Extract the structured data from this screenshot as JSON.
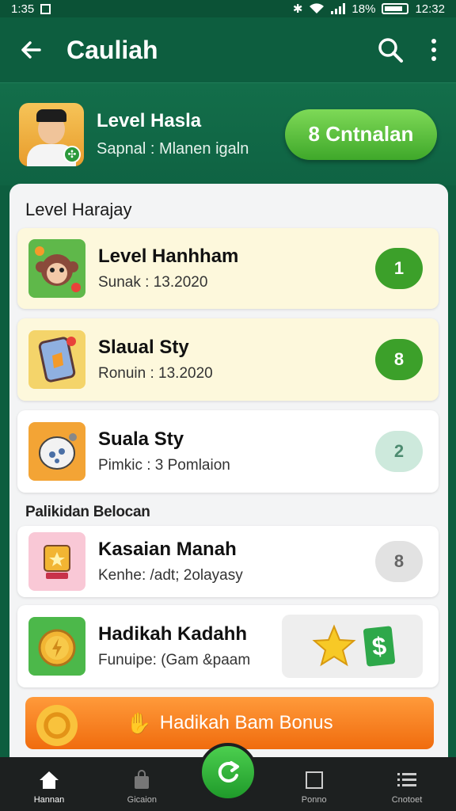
{
  "status_bar": {
    "left_text": "1:35",
    "battery_text": "18%",
    "time": "12:32"
  },
  "app_bar": {
    "title": "Cauliah",
    "back_icon": "arrow-left-icon",
    "search_icon": "search-icon",
    "menu_icon": "more-vertical-icon"
  },
  "profile": {
    "name": "Level Hasla",
    "subtitle": "Sapnal : Mlanen igaln",
    "claim_label": "8 Cntnalan"
  },
  "section1": {
    "title": "Level Harajay",
    "items": [
      {
        "title": "Level Hanhham",
        "subtitle": "Sunak : 13.2020",
        "badge": "1"
      },
      {
        "title": "Slaual Sty",
        "subtitle": "Ronuin : 13.2020",
        "badge": "8"
      },
      {
        "title": "Suala Sty",
        "subtitle": "Pimkic : 3 Pomlaion",
        "badge": "2"
      }
    ]
  },
  "section2": {
    "title": "Palikidan Belocan",
    "items": [
      {
        "title": "Kasaian Manah",
        "subtitle": "Kenhe: /adt; 2olayasy",
        "badge": "8"
      },
      {
        "title": "Hadikah Kadahh",
        "subtitle": "Funuipe: (Gam &paam",
        "reward_symbol": "$"
      }
    ]
  },
  "bonus_button": {
    "label": "Hadikah Bam Bonus"
  },
  "bottom_nav": [
    {
      "label": "Hannan",
      "icon": "home-icon"
    },
    {
      "label": "Gicaion",
      "icon": "bag-icon"
    },
    {
      "label": "Ponno",
      "icon": "square-icon"
    },
    {
      "label": "Cnotoet",
      "icon": "list-icon"
    }
  ],
  "colors": {
    "brand_green": "#0d5e3f",
    "accent_green": "#3ca02a",
    "orange": "#f57c16"
  }
}
